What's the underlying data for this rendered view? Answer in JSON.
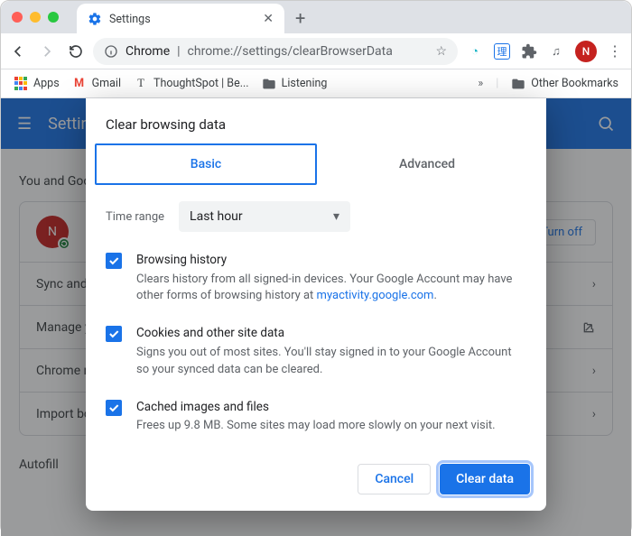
{
  "tab_title": "Settings",
  "url_domain": "Chrome",
  "url_path": "chrome://settings/clearBrowserData",
  "bookmarks": {
    "apps": "Apps",
    "gmail": "Gmail",
    "ts": "ThoughtSpot | Be...",
    "listening": "Listening",
    "other": "Other Bookmarks"
  },
  "settings": {
    "title": "Settings",
    "section": "You and Google",
    "turn_off": "Turn off",
    "rows": [
      "Sync and",
      "Manage y",
      "Chrome n",
      "Import bo"
    ],
    "autofill": "Autofill",
    "avatar_initial": "N"
  },
  "dialog": {
    "title": "Clear browsing data",
    "tabs": {
      "basic": "Basic",
      "advanced": "Advanced"
    },
    "time_label": "Time range",
    "time_value": "Last hour",
    "options": [
      {
        "title": "Browsing history",
        "desc_a": "Clears history from all signed-in devices. Your Google Account may have other forms of browsing history at ",
        "link": "myaccount.google.com",
        "link_display": "myactivity.google.com",
        "desc_b": "."
      },
      {
        "title": "Cookies and other site data",
        "desc": "Signs you out of most sites. You'll stay signed in to your Google Account so your synced data can be cleared."
      },
      {
        "title": "Cached images and files",
        "desc": "Frees up 9.8 MB. Some sites may load more slowly on your next visit."
      }
    ],
    "cancel": "Cancel",
    "clear": "Clear data"
  }
}
